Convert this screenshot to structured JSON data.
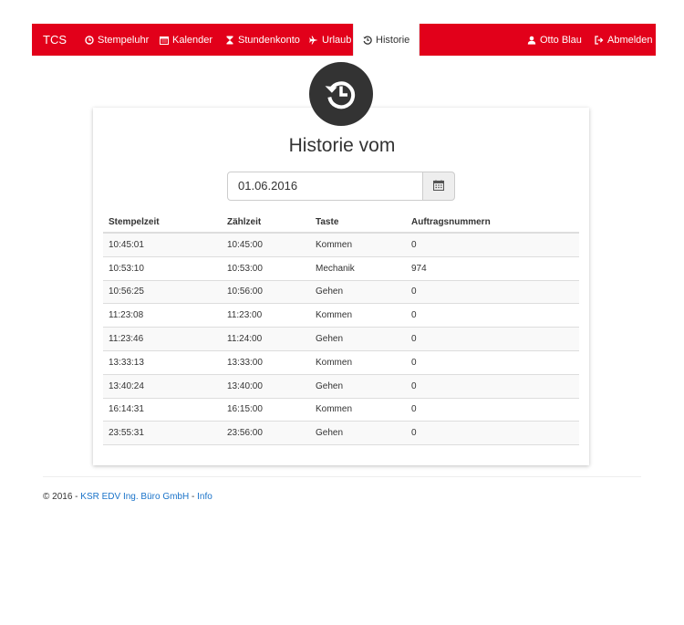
{
  "navbar": {
    "brand": "TCS",
    "items": [
      {
        "label": "Stempeluhr",
        "icon": "clock-icon"
      },
      {
        "label": "Kalender",
        "icon": "calendar-icon"
      },
      {
        "label": "Stundenkonto",
        "icon": "hourglass-icon"
      },
      {
        "label": "Urlaub",
        "icon": "plane-icon"
      },
      {
        "label": "Historie",
        "icon": "history-icon",
        "active": true
      }
    ],
    "user": {
      "label": "Otto Blau",
      "icon": "user-icon"
    },
    "logout": {
      "label": "Abmelden",
      "icon": "logout-icon"
    },
    "color": "#e2001a"
  },
  "history": {
    "title": "Historie vom",
    "date": "01.06.2016",
    "columns": [
      "Stempelzeit",
      "Zählzeit",
      "Taste",
      "Auftragsnummern"
    ],
    "rows": [
      [
        "10:45:01",
        "10:45:00",
        "Kommen",
        "0"
      ],
      [
        "10:53:10",
        "10:53:00",
        "Mechanik",
        "974"
      ],
      [
        "10:56:25",
        "10:56:00",
        "Gehen",
        "0"
      ],
      [
        "11:23:08",
        "11:23:00",
        "Kommen",
        "0"
      ],
      [
        "11:23:46",
        "11:24:00",
        "Gehen",
        "0"
      ],
      [
        "13:33:13",
        "13:33:00",
        "Kommen",
        "0"
      ],
      [
        "13:40:24",
        "13:40:00",
        "Gehen",
        "0"
      ],
      [
        "16:14:31",
        "16:15:00",
        "Kommen",
        "0"
      ],
      [
        "23:55:31",
        "23:56:00",
        "Gehen",
        "0"
      ]
    ]
  },
  "footer": {
    "prefix": "© 2016 - ",
    "company": "KSR EDV Ing. Büro GmbH",
    "separator": " - ",
    "info": "Info"
  }
}
